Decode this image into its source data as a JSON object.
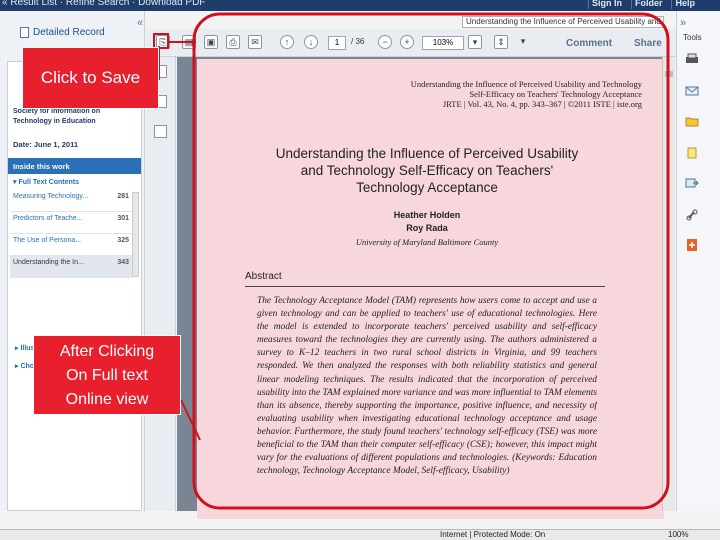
{
  "topbar": {
    "breadcrumb": "« Result List · Refine Search · Download PDF",
    "links": [
      "Sign In",
      "Folder",
      "Help"
    ]
  },
  "left": {
    "detailed_record": "Detailed Record",
    "collapse": "«",
    "publication": "Society for Information on Technology in Education",
    "date": "Date: June 1, 2011",
    "inside_header": "Inside this work",
    "full_text_contents": "▾ Full Text Contents",
    "toc": [
      {
        "label": "Measuring Technology...",
        "page": "281"
      },
      {
        "label": "Predictors of Teache...",
        "page": "301"
      },
      {
        "label": "The Use of Persona...",
        "page": "325"
      },
      {
        "label": "Understanding the In...",
        "page": "343"
      }
    ],
    "illustrations": "▸ Illustrations",
    "choose_another": "▸ Choose Another Issue"
  },
  "viewer": {
    "tab_title": "Understanding the Influence of Perceived Usability and",
    "page_current": "1",
    "page_total": "/ 36",
    "zoom": "103%",
    "comment": "Comment",
    "share": "Share"
  },
  "tools": {
    "label": "Tools",
    "collapse": "»"
  },
  "document": {
    "header_lines": [
      "Understanding the Influence of Perceived Usability and Technology",
      "Self-Efficacy on Teachers' Technology Acceptance",
      "JRTE | Vol. 43, No. 4, pp. 343–367 | ©2011 ISTE | iste.org"
    ],
    "title_lines": [
      "Understanding the Influence of Perceived Usability",
      "and Technology Self-Efficacy on Teachers'",
      "Technology Acceptance"
    ],
    "authors": [
      "Heather Holden",
      "Roy Rada"
    ],
    "affiliation": "University of Maryland Baltimore County",
    "abstract_heading": "Abstract",
    "abstract_text": "The Technology Acceptance Model (TAM) represents how users come to accept and use a given technology and can be applied to teachers' use of educational technologies. Here the model is extended to incorporate teachers' perceived usability and self-efficacy measures toward the technologies they are currently using. The authors administered a survey to K–12 teachers in two rural school districts in Virginia, and 99 teachers responded. We then analyzed the responses with both reliability statistics and general linear modeling techniques. The results indicated that the incorporation of perceived usability into the TAM explained more variance and was more influential to TAM elements than its absence, thereby supporting the importance, positive influence, and necessity of evaluating usability when investigating educational technology acceptance and usage behavior. Furthermore, the study found teachers' technology self-efficacy (TSE) was more beneficial to the TAM than their computer self-efficacy (CSE); however, this impact might vary for the evaluations of different populations and technologies. (Keywords: Education technology, Technology Acceptance Model, Self-efficacy, Usability)"
  },
  "status": {
    "zone": "Internet | Protected Mode: On",
    "zoom": "100%"
  },
  "callouts": {
    "save": "Click to Save",
    "after": [
      "After Clicking",
      "On Full text",
      "Online view"
    ]
  },
  "colors": {
    "callout": "#e8202e",
    "highlight_ring": "#d0101c",
    "page_tint": "#f7d7dc",
    "link": "#2a6fb7"
  }
}
